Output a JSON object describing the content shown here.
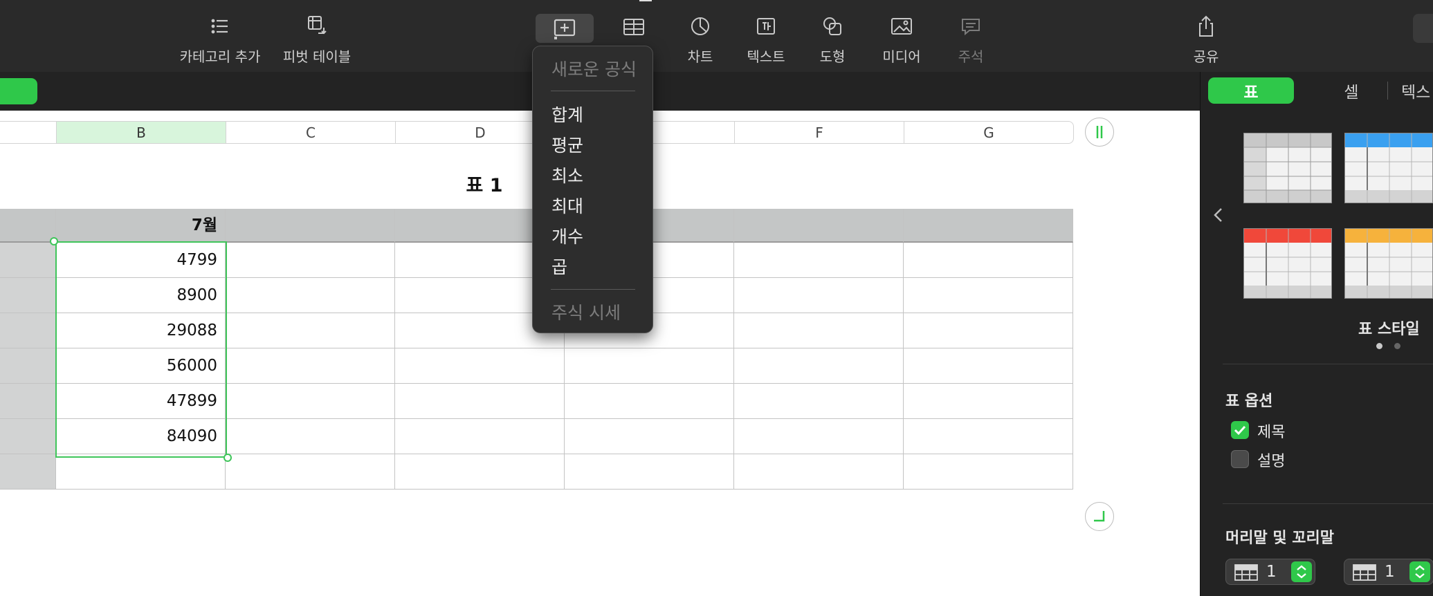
{
  "toolbar": {
    "items": [
      {
        "label": "카테고리 추가",
        "icon": "list-icon"
      },
      {
        "label": "피벗 테이블",
        "icon": "pivot-table-icon"
      },
      {
        "label": "",
        "icon": "insert-formula-icon"
      },
      {
        "label": "",
        "icon": "table-icon"
      },
      {
        "label": "차트",
        "icon": "chart-icon"
      },
      {
        "label": "텍스트",
        "icon": "text-box-icon"
      },
      {
        "label": "도형",
        "icon": "shape-icon"
      },
      {
        "label": "미디어",
        "icon": "media-icon"
      },
      {
        "label": "주석",
        "icon": "comment-icon"
      },
      {
        "label": "공유",
        "icon": "share-icon"
      }
    ]
  },
  "columns": [
    "B",
    "C",
    "D",
    "",
    "F",
    "G"
  ],
  "table": {
    "title": "표 1",
    "header": "7월",
    "values": [
      "4799",
      "8900",
      "29088",
      "56000",
      "47899",
      "84090"
    ]
  },
  "formula_menu": {
    "header": "새로운 공식",
    "items": [
      "합계",
      "평균",
      "최소",
      "최대",
      "개수",
      "곱"
    ],
    "footer": "주식 시세"
  },
  "sidebar": {
    "tabs": [
      "표",
      "셀",
      "텍스"
    ],
    "style_label": "표 스타일",
    "options_title": "표 옵션",
    "option_title": "제목",
    "option_caption": "설명",
    "header_footer_title": "머리말 및 꼬리말",
    "header_rows": "1",
    "footer_rows": "1"
  },
  "colors": {
    "accent": "#2fc84a",
    "toolbar_bg": "#2a2a2a",
    "sidebar_bg": "#232323",
    "header_row": "#c4c6c6",
    "selection": "#3fc55a",
    "style_blue": "#3aa0f0",
    "style_red": "#f0483a",
    "style_orange": "#f6b23c"
  }
}
